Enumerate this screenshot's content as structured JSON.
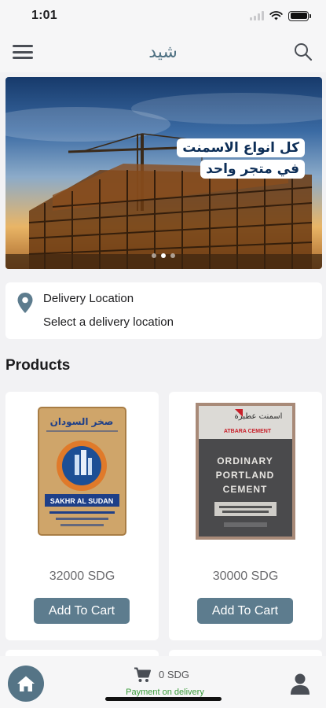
{
  "status_bar": {
    "time": "1:01"
  },
  "header": {
    "title": "شيد",
    "menu_icon": "menu-icon",
    "search_icon": "search-icon"
  },
  "banner": {
    "line1": "كل انواع الاسمنت",
    "line2": "في متجر واحد",
    "slides": 3,
    "active_slide": 2
  },
  "delivery": {
    "title": "Delivery Location",
    "subtitle": "Select a delivery location",
    "icon": "location-pin-icon"
  },
  "products_section": {
    "title": "Products"
  },
  "products": [
    {
      "price": "32000 SDG",
      "add_label": "Add To Cart",
      "bag_arabic": "صخر السودان",
      "bag_brand": "SAKHR AL SUDAN"
    },
    {
      "price": "30000 SDG",
      "add_label": "Add To Cart",
      "bag_arabic": "اسمنت عطبرة",
      "bag_brand": "ATBARA CEMENT",
      "bag_type": [
        "ORDINARY",
        "PORTLAND",
        "CEMENT"
      ]
    }
  ],
  "bottom_bar": {
    "cart_total": "0 SDG",
    "payment_label": "Payment on delivery",
    "home_icon": "home-icon",
    "cart_icon": "cart-icon",
    "profile_icon": "user-icon"
  },
  "colors": {
    "accent": "#5d7c8e",
    "home_button": "#557486",
    "title": "#4f7183",
    "payment_text": "#3a9b3a",
    "background": "#f2f2f4"
  }
}
